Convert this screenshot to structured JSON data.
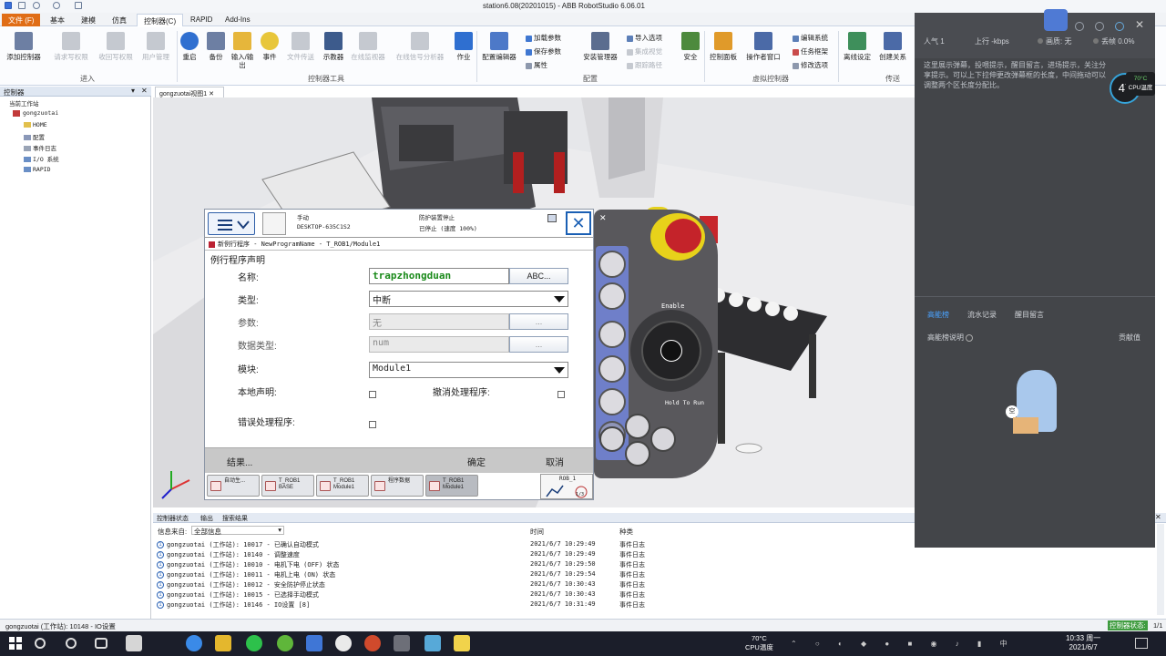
{
  "window": {
    "title": "station6.08(20201015) - ABB RobotStudio 6.06.01"
  },
  "tabs": [
    "文件 (F)",
    "基本",
    "建模",
    "仿真",
    "控制器(C)",
    "RAPID",
    "Add-Ins"
  ],
  "ribbon": {
    "add_controller": "添加控制器",
    "request_write": "请求写权限",
    "revoke_write": "收回写权限",
    "user_mgmt": "用户管理",
    "restart": "重启",
    "backup": "备份",
    "io": "输入/输出",
    "event": "事件",
    "file_transfer": "文件传送",
    "teach": "示教器",
    "online_monitor": "在线监视器",
    "online_signal": "在线信号分析器",
    "job": "作业",
    "config_editor": "配置编辑器",
    "load_params": "加载参数",
    "save_params": "保存参数",
    "attributes": "属性",
    "install_mgr": "安装管理器",
    "import_options": "导入选项",
    "integrated_vision": "集成视觉",
    "follow_path": "跟踪路径",
    "safety": "安全",
    "control_panel": "控制面板",
    "operator_window": "操作者窗口",
    "edit_system": "编辑系统",
    "task_frame": "任务框架",
    "modify_options": "修改选项",
    "offline_settings": "离线设定",
    "create_relation": "创建关系",
    "groups": [
      "进入",
      "控制器工具",
      "配置",
      "虚拟控制器",
      "传送"
    ]
  },
  "left_panel": {
    "title": "控制器",
    "tree": [
      "当前工作站",
      "gongzuotai",
      "HOME",
      "配置",
      "事件日志",
      "I/O 系统",
      "RAPID"
    ]
  },
  "document_tab": "gongzuotai视图1",
  "tp": {
    "mode": "手动",
    "host": "DESKTOP-635C1S2",
    "guard": "防护装置停止",
    "state": "已停止 (速度 100%)",
    "breadcrumb": "新例行程序 - NewProgramName - T_ROB1/Module1",
    "section": "例行程序声明",
    "name_label": "名称:",
    "name_value": "trapzhongduan",
    "abc_button": "ABC...",
    "type_label": "类型:",
    "type_value": "中断",
    "params_label": "参数:",
    "params_value": "无",
    "datatype_label": "数据类型:",
    "datatype_value": "num",
    "dots": "...",
    "module_label": "模块:",
    "module_value": "Module1",
    "local_label": "本地声明:",
    "undo_label": "撤消处理程序:",
    "error_label": "错误处理程序:",
    "result_button": "结果...",
    "ok_button": "确定",
    "cancel_button": "取消",
    "taskbar": [
      {
        "line1": "自动生...",
        "line2": ""
      },
      {
        "line1": "T_ROB1",
        "line2": "BASE"
      },
      {
        "line1": "T_ROB1",
        "line2": "Module1"
      },
      {
        "line1": "程序数据",
        "line2": ""
      },
      {
        "line1": "T_ROB1",
        "line2": "Module1"
      }
    ],
    "rob_label": "ROB_1",
    "rob_fraction": "1/3"
  },
  "flexpendant": {
    "enable": "Enable",
    "hold_to_run": "Hold To Run"
  },
  "output": {
    "tabs": [
      "控制器状态",
      "输出",
      "搜索结果"
    ],
    "filter_label": "信息来自:",
    "filter_value": "全部信息",
    "col_time": "时间",
    "col_category": "种类",
    "rows": [
      {
        "msg": "gongzuotai (工作站): 10017 - 已确认自动模式",
        "time": "2021/6/7 10:29:49",
        "cat": "事件日志"
      },
      {
        "msg": "gongzuotai (工作站): 10140 - 调整速度",
        "time": "2021/6/7 10:29:49",
        "cat": "事件日志"
      },
      {
        "msg": "gongzuotai (工作站): 10010 - 电机下电 (OFF) 状态",
        "time": "2021/6/7 10:29:50",
        "cat": "事件日志"
      },
      {
        "msg": "gongzuotai (工作站): 10011 - 电机上电 (ON) 状态",
        "time": "2021/6/7 10:29:54",
        "cat": "事件日志"
      },
      {
        "msg": "gongzuotai (工作站): 10012 - 安全防护停止状态",
        "time": "2021/6/7 10:30:43",
        "cat": "事件日志"
      },
      {
        "msg": "gongzuotai (工作站): 10015 - 已选择手动模式",
        "time": "2021/6/7 10:30:43",
        "cat": "事件日志"
      },
      {
        "msg": "gongzuotai (工作站): 10146 - IO设置 [8]",
        "time": "2021/6/7 10:31:49",
        "cat": "事件日志"
      }
    ]
  },
  "status_bar": {
    "text": "gongzuotai (工作站): 10148 - IO设置",
    "right_label": "控制器状态:",
    "right_value": "1/1"
  },
  "overlay": {
    "popularity_label": "人气",
    "popularity_value": "1",
    "upload": "上行 -kbps",
    "quality": "画质: 无",
    "loss": "丢帧 0.0%",
    "hint": "这里展示弹幕，投喂提示，醒目留言，进场提示，关注分享提示。可以上下拉伸更改弹幕框的长度，中间拖动可以调整两个区长度分配比。",
    "cpu_percent": "47",
    "cpu_temp": "70°C",
    "cpu_label": "CPU温度",
    "tabs": [
      "高能榜",
      "流水记录",
      "醒目留言"
    ],
    "rank_label": "高能榜说明",
    "contrib_label": "贡献值",
    "avatar_text": "空"
  },
  "taskbar": {
    "temp": "70°C",
    "temp_label": "CPU温度",
    "time": "10:33 周一",
    "date": "2021/6/7"
  }
}
